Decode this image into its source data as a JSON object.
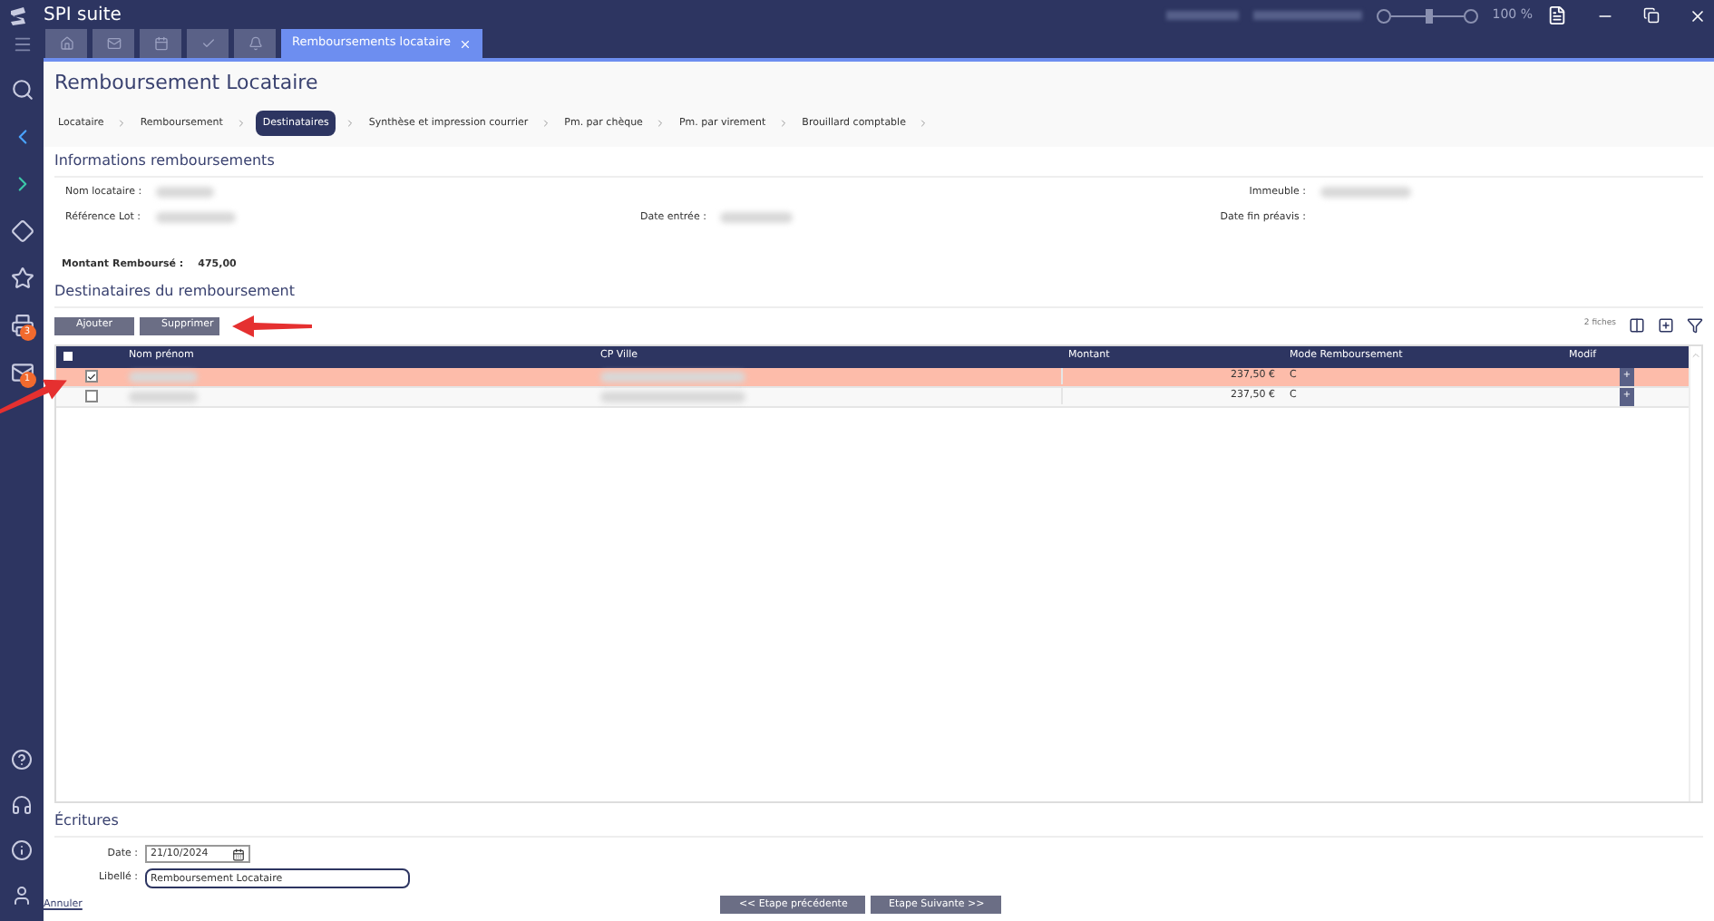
{
  "window": {
    "title": "SPI suite",
    "zoom": "100 %",
    "zoom_level": {
      "level": 0.5
    }
  },
  "tabs": [
    {
      "kind": "icon",
      "selected": false
    },
    {
      "kind": "icon",
      "selected": false
    },
    {
      "kind": "icon",
      "selected": false
    },
    {
      "kind": "icon",
      "selected": false
    },
    {
      "kind": "icon",
      "selected": false
    },
    {
      "kind": "text",
      "label": "Remboursements locataire",
      "selected": true
    }
  ],
  "sidebar": {
    "badges": [
      "3",
      "1"
    ]
  },
  "page_title": "Remboursement Locataire",
  "steps": [
    {
      "label": "Locataire",
      "selected": false
    },
    {
      "label": "Remboursement",
      "selected": false
    },
    {
      "label": "Destinataires",
      "selected": true
    },
    {
      "label": "Synthèse et impression courrier",
      "selected": false
    },
    {
      "label": "Pm. par chèque",
      "selected": false
    },
    {
      "label": "Pm. par virement",
      "selected": false
    },
    {
      "label": "Brouillard comptable",
      "selected": false
    }
  ],
  "info": {
    "heading": "Informations remboursements",
    "nom_locataire": "Nom locataire :",
    "reference_lot": "Référence Lot :",
    "date_entree": "Date entrée :",
    "immeuble": "Immeuble :",
    "date_fin_preavis": "Date fin préavis :",
    "montant_label": "Montant Remboursé :",
    "montant": "475,00"
  },
  "recipients": {
    "heading": "Destinataires du remboursement",
    "buttons": [
      "Ajouter",
      "Supprimer"
    ],
    "count": "2 fiches",
    "all_checked": false,
    "columns": [
      "Nom prénom",
      "CP Ville",
      "Montant",
      "Mode Remboursement",
      "Modif"
    ],
    "rows": [
      {
        "selected": true,
        "checked": true,
        "montant": "237,50 €",
        "mode": "C",
        "action": "+"
      },
      {
        "selected": false,
        "checked": false,
        "montant": "237,50 €",
        "mode": "C",
        "action": "+"
      }
    ]
  },
  "ecritures": {
    "heading": "Écritures",
    "date_label": "Date :",
    "date": "21/10/2024",
    "libelle_label": "Libellé :",
    "libelle": "Remboursement Locataire"
  },
  "footer": {
    "cancel": "Annuler",
    "previous": "<< Etape précédente",
    "next": "Etape Suivante >>"
  }
}
